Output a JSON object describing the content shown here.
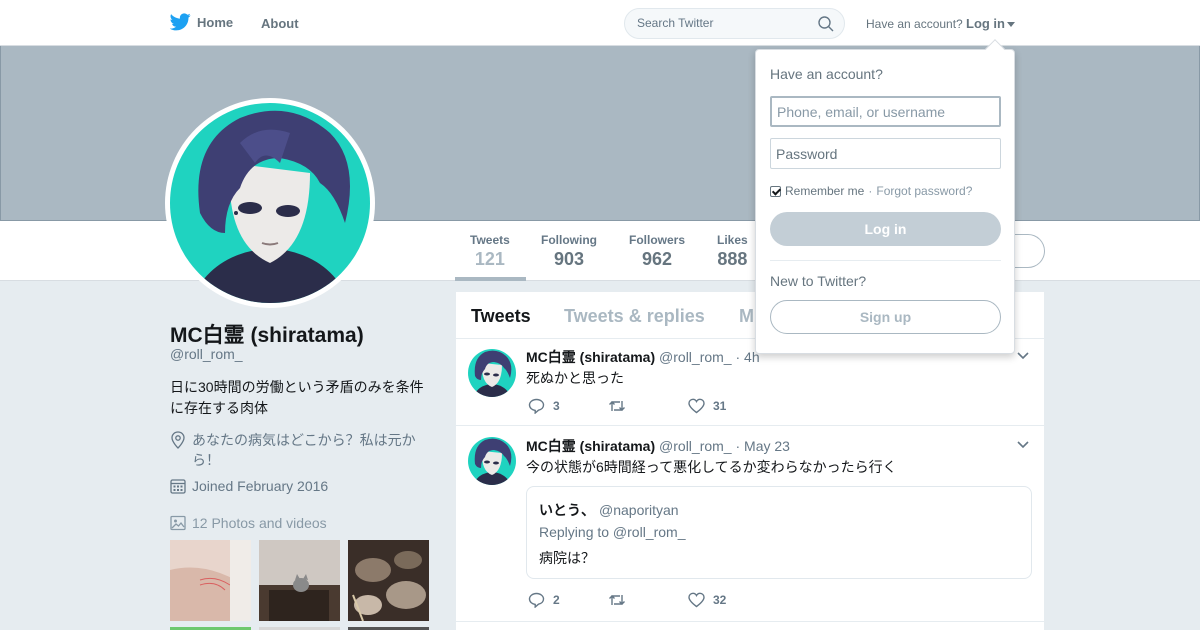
{
  "nav": {
    "home_label": "Home",
    "about_label": "About",
    "search_placeholder": "Search Twitter",
    "have_account": "Have an account?",
    "login_label": "Log in"
  },
  "profile": {
    "name": "MC白霊 (shiratama)",
    "handle": "@roll_rom_",
    "bio": "日に30時間の労働という矛盾のみを条件に存在する肉体",
    "location": "あなたの病気はどこから？私は元から！",
    "joined": "Joined February 2016",
    "photos": "12 Photos and videos"
  },
  "stats": [
    {
      "label": "Tweets",
      "value": "121"
    },
    {
      "label": "Following",
      "value": "903"
    },
    {
      "label": "Followers",
      "value": "962"
    },
    {
      "label": "Likes",
      "value": "888"
    }
  ],
  "tabs": [
    "Tweets",
    "Tweets & replies",
    "M"
  ],
  "tweets": [
    {
      "name": "MC白霊 (shiratama)",
      "handle": "@roll_rom_",
      "time": "· 4h",
      "text": "死ぬかと思った",
      "replies": "3",
      "likes": "31"
    },
    {
      "name": "MC白霊 (shiratama)",
      "handle": "@roll_rom_",
      "time": "· May 23",
      "text": "今の状態が6時間経って悪化してるか変わらなかったら行く",
      "quote": {
        "name": "いとう、",
        "handle": "@naporityan",
        "replying": "Replying to @roll_rom_",
        "text": "病院は？"
      },
      "replies": "2",
      "likes": "32"
    }
  ],
  "login_dropdown": {
    "title": "Have an account?",
    "username_placeholder": "Phone, email, or username",
    "password_placeholder": "Password",
    "remember": "Remember me",
    "dot": "·",
    "forgot": "Forgot password?",
    "login_button": "Log in",
    "new_to": "New to Twitter?",
    "signup_button": "Sign up"
  },
  "colors": {
    "banner": "#aab8c2",
    "avatar_bg": "#1fd3c0",
    "text_muted": "#657786"
  },
  "icons": [
    "twitter-bird-icon",
    "search-icon",
    "location-icon",
    "calendar-icon",
    "photo-icon",
    "reply-icon",
    "retweet-icon",
    "like-icon",
    "chevron-down-icon"
  ]
}
